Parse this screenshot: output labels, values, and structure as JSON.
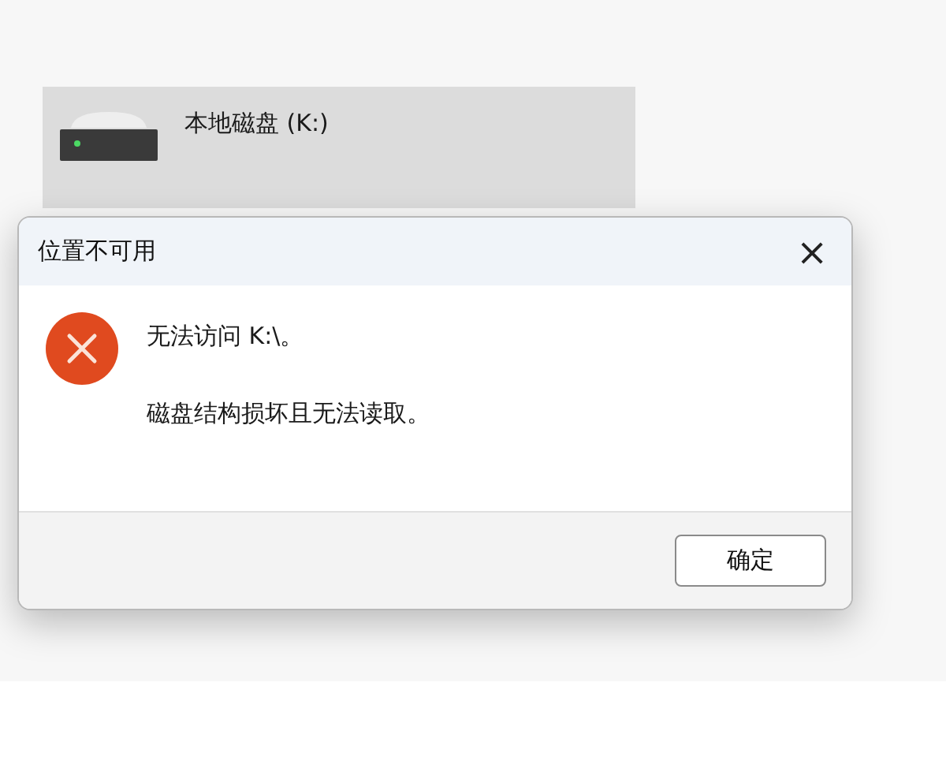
{
  "drive": {
    "label": "本地磁盘 (K:)"
  },
  "dialog": {
    "title": "位置不可用",
    "close": "×",
    "messages": [
      "无法访问 K:\\。",
      "磁盘结构损坏且无法读取。"
    ],
    "buttons": [
      "确定"
    ]
  }
}
